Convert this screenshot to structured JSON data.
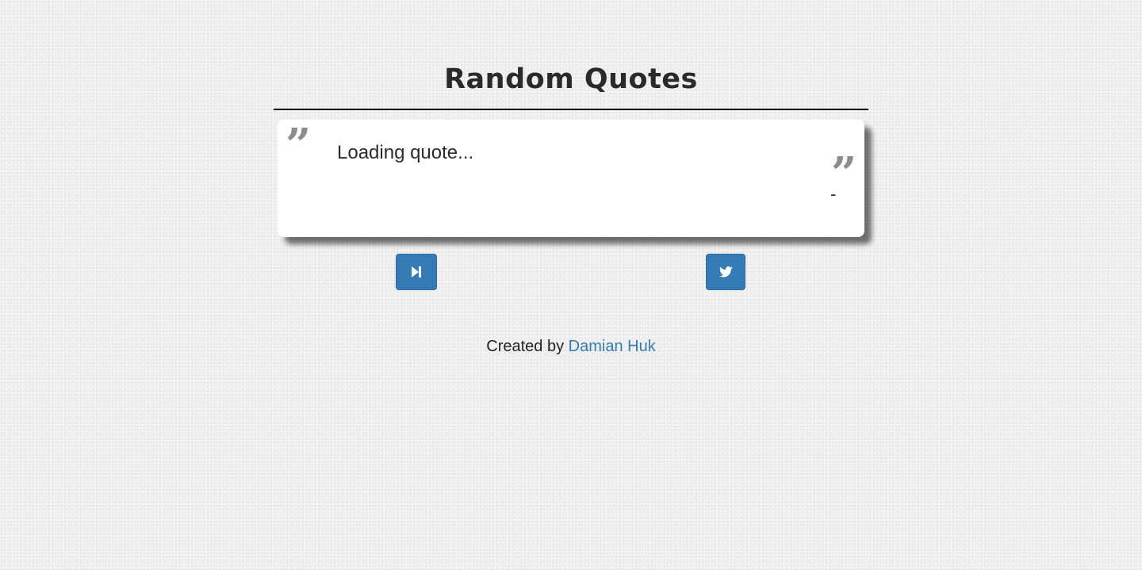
{
  "header": {
    "title": "Random Quotes"
  },
  "quote": {
    "text": "Loading quote...",
    "author": "-",
    "open_mark": "”",
    "close_mark": "”"
  },
  "actions": {
    "next_icon": "step-forward-icon",
    "tweet_icon": "twitter-icon"
  },
  "footer": {
    "prefix": "Created by",
    "author_link": "Damian Huk"
  },
  "colors": {
    "accent": "#337ab7",
    "background": "#f0f0f0",
    "card": "#ffffff"
  }
}
